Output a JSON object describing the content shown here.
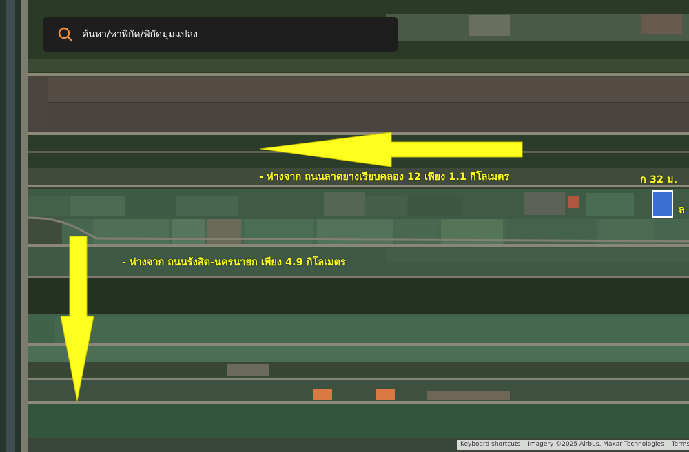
{
  "search": {
    "placeholder": "ค้นหา/หาพิกัด/พิกัดมุมแปลง",
    "icon": "search-icon",
    "icon_color": "#f5913c"
  },
  "annotations": {
    "distance_1": "-  ห่างจาก ถนนลาดยางเรียบคลอง 12 เพียง 1.1 กิโลเมตร",
    "distance_2": "-  ห่างจาก ถนนรังสิต-นครนายก  เพียง  4.9  กิโลเมตร",
    "frontage": "ก 32 ม.",
    "depth": "ล"
  },
  "colors": {
    "annotation": "#ffff1e",
    "parcel_fill": "#3b6fd4",
    "parcel_border": "#ffffff"
  },
  "attribution": {
    "keyboard": "Keyboard shortcuts",
    "imagery": "Imagery ©2025 Airbus, Maxar Technologies",
    "terms": "Terms"
  }
}
